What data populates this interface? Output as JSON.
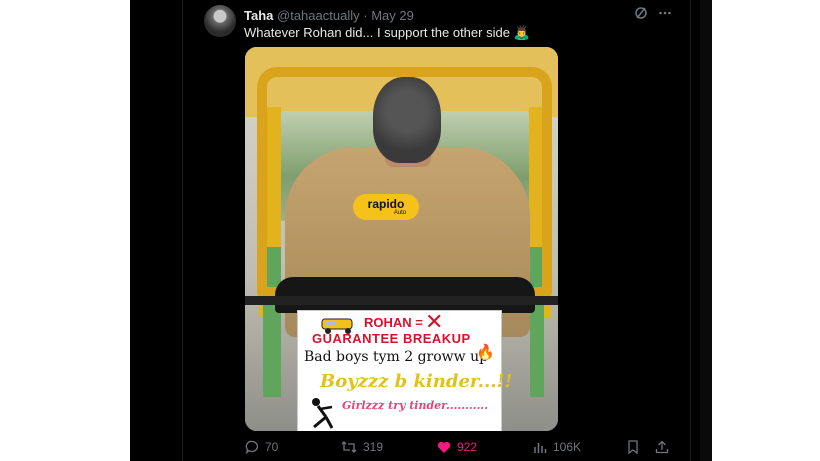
{
  "tweet": {
    "display_name": "Taha",
    "handle": "@tahaactually",
    "separator": "·",
    "date": "May 29",
    "text": "Whatever Rohan did... I support the other side 🙇‍♂️"
  },
  "sign": {
    "line1": "ROHAN =",
    "line2": "GUARANTEE BREAKUP",
    "line3": "Bad boys tym 2 groww up",
    "line4": "Boyzzz b kinder...!!",
    "line5": "Girlzzz try tinder..........."
  },
  "jacket_logo": {
    "brand": "rapido",
    "sub": "Auto"
  },
  "actions": {
    "replies": "70",
    "reposts": "319",
    "likes": "922",
    "views": "106K"
  },
  "colors": {
    "background": "#000000",
    "text_primary": "#e7e9ea",
    "text_secondary": "#71767b",
    "like_accent": "#f91880"
  },
  "icons": [
    "grok-icon",
    "more-icon",
    "reply-icon",
    "repost-icon",
    "heart-icon",
    "views-icon",
    "bookmark-icon",
    "share-icon"
  ]
}
